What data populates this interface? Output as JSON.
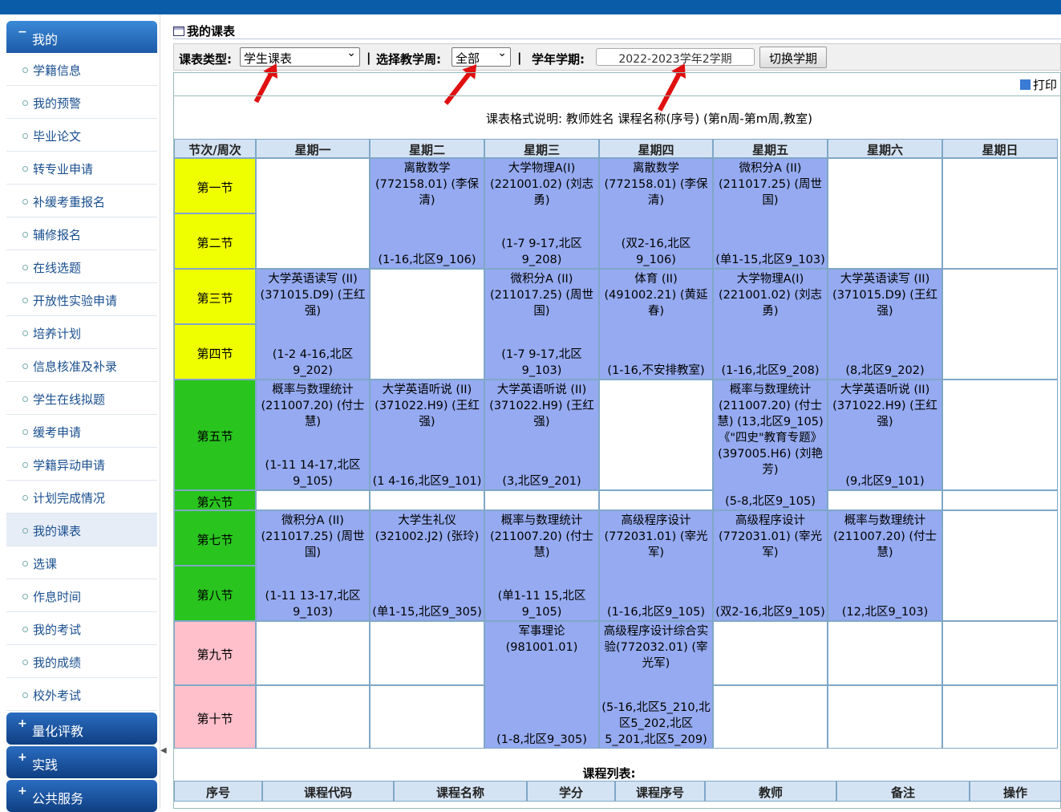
{
  "sidebar": {
    "sections": [
      {
        "sign": "−",
        "label": "我的"
      },
      {
        "sign": "+",
        "label": "量化评教"
      },
      {
        "sign": "+",
        "label": "实践"
      },
      {
        "sign": "+",
        "label": "公共服务"
      }
    ],
    "items": [
      "学籍信息",
      "我的预警",
      "毕业论文",
      "转专业申请",
      "补缓考重报名",
      "辅修报名",
      "在线选题",
      "开放性实验申请",
      "培养计划",
      "信息核准及补录",
      "学生在线拟题",
      "缓考申请",
      "学籍异动申请",
      "计划完成情况",
      "我的课表",
      "选课",
      "作息时间",
      "我的考试",
      "我的成绩",
      "校外考试"
    ],
    "active_item": "我的课表"
  },
  "page": {
    "title": "我的课表"
  },
  "filters": {
    "type_label": "课表类型:",
    "type_value": "学生课表",
    "sep": "|",
    "week_label": "选择教学周:",
    "week_value": "全部",
    "term_label": "学年学期:",
    "term_value": "2022-2023学年2学期",
    "switch_button": "切换学期"
  },
  "print_label": "打印",
  "legend": "课表格式说明: 教师姓名 课程名称(序号) (第n周-第m周,教室)",
  "timetable": {
    "corner": "节次/周次",
    "days": [
      "星期一",
      "星期二",
      "星期三",
      "星期四",
      "星期五",
      "星期六",
      "星期日"
    ],
    "periods": [
      "第一节",
      "第二节",
      "第三节",
      "第四节",
      "第五节",
      "第六节",
      "第七节",
      "第八节",
      "第九节",
      "第十节"
    ],
    "courses": {
      "tue_1": {
        "top": "离散数学 (772158.01) (李保清)",
        "bottom": "(1-16,北区9_106)"
      },
      "wed_1": {
        "top": "大学物理A(I) (221001.02) (刘志勇)",
        "bottom": "(1-7 9-17,北区9_208)"
      },
      "thu_1": {
        "top": "离散数学 (772158.01) (李保清)",
        "bottom": "(双2-16,北区9_106)"
      },
      "fri_1": {
        "top": "微积分A (II) (211017.25) (周世国)",
        "bottom": "(单1-15,北区9_103)"
      },
      "mon_3": {
        "top": "大学英语读写 (II) (371015.D9) (王红强)",
        "bottom": "(1-2 4-16,北区9_202)"
      },
      "wed_3": {
        "top": "微积分A (II) (211017.25) (周世国)",
        "bottom": "(1-7 9-17,北区9_103)"
      },
      "thu_3": {
        "top": "体育 (II) (491002.21) (黄延春)",
        "bottom": "(1-16,不安排教室)"
      },
      "fri_3": {
        "top": "大学物理A(I) (221001.02) (刘志勇)",
        "bottom": "(1-16,北区9_208)"
      },
      "sat_3": {
        "top": "大学英语读写 (II) (371015.D9) (王红强)",
        "bottom": "(8,北区9_202)"
      },
      "mon_5": {
        "top": "概率与数理统计 (211007.20) (付士慧)",
        "bottom": "(1-11 14-17,北区9_105)"
      },
      "tue_5": {
        "top": "大学英语听说 (II) (371022.H9) (王红强)",
        "bottom": "(1 4-16,北区9_101)"
      },
      "wed_5": {
        "top": "大学英语听说 (II) (371022.H9) (王红强)",
        "bottom": "(3,北区9_201)"
      },
      "fri_5": {
        "top": "概率与数理统计 (211007.20) (付士慧) (13,北区9_105) 《\"四史\"教育专题》 (397005.H6) (刘艳芳)",
        "bottom": "(5-8,北区9_105)"
      },
      "sat_5": {
        "top": "大学英语听说 (II) (371022.H9) (王红强)",
        "bottom": "(9,北区9_101)"
      },
      "mon_7": {
        "top": "微积分A (II) (211017.25) (周世国)",
        "bottom": "(1-11 13-17,北区9_103)"
      },
      "tue_7": {
        "top": "大学生礼仪 (321002.J2) (张玲)",
        "bottom": "(单1-15,北区9_305)"
      },
      "wed_7": {
        "top": "概率与数理统计 (211007.20) (付士慧)",
        "bottom": "(单1-11 15,北区9_105)"
      },
      "thu_7": {
        "top": "高级程序设计 (772031.01) (宰光军)",
        "bottom": "(1-16,北区9_105)"
      },
      "fri_7": {
        "top": "高级程序设计 (772031.01) (宰光军)",
        "bottom": "(双2-16,北区9_105)"
      },
      "sat_7": {
        "top": "概率与数理统计 (211007.20) (付士慧)",
        "bottom": "(12,北区9_103)"
      },
      "wed_9": {
        "top": "军事理论 (981001.01)",
        "bottom": "(1-8,北区9_305)"
      },
      "thu_9": {
        "top": "高级程序设计综合实验(772032.01) (宰光军)",
        "bottom": "(5-16,北区5_210,北区5_202,北区5_201,北区5_209)"
      }
    }
  },
  "course_list": {
    "title": "课程列表:",
    "headers": [
      "序号",
      "课程代码",
      "课程名称",
      "学分",
      "课程序号",
      "教师",
      "备注",
      "操作"
    ]
  },
  "colors": {
    "period_morning": "#f0ff00",
    "period_afternoon": "#29c41e",
    "period_evening": "#ffc0cb",
    "course_bg": "#95aaf0",
    "topbar": "#0a5ba8",
    "arrow": "#e01010"
  }
}
